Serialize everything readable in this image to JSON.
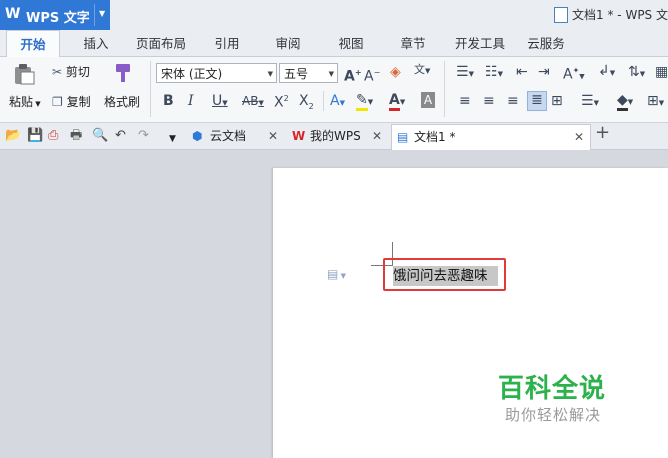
{
  "app": {
    "name": "WPS 文字",
    "logo_letter": "W",
    "window_title": "文档1 * - WPS 文"
  },
  "menu": {
    "tabs": [
      "开始",
      "插入",
      "页面布局",
      "引用",
      "审阅",
      "视图",
      "章节",
      "开发工具",
      "云服务"
    ],
    "active": "开始"
  },
  "ribbon": {
    "paste": "粘贴",
    "cut": "剪切",
    "copy": "复制",
    "format_painter": "格式刷",
    "font_name": "宋体 (正文)",
    "font_size": "五号"
  },
  "doc_tabs": [
    {
      "label": "云文档"
    },
    {
      "label": "我的WPS"
    },
    {
      "label": "文档1 *"
    }
  ],
  "document": {
    "text": "饿问问去恶趣味"
  },
  "watermark": {
    "title": "百科全说",
    "subtitle": "助你轻松解决"
  },
  "colors": {
    "accent": "#2f78d6",
    "highlight_box": "#e03a3a",
    "watermark_green": "#2bb24c"
  }
}
